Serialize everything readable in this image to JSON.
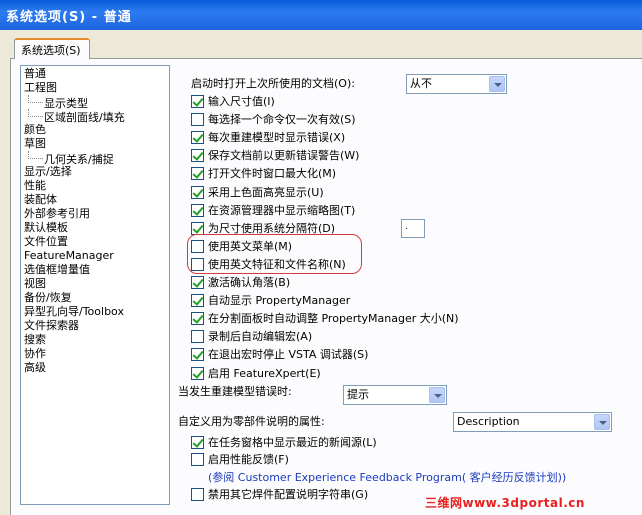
{
  "window": {
    "title": "系统选项(S) - 普通"
  },
  "tab": {
    "label": "系统选项(S)"
  },
  "tree": [
    {
      "label": "普通",
      "level": 1
    },
    {
      "label": "工程图",
      "level": 1
    },
    {
      "label": "显示类型",
      "level": 2
    },
    {
      "label": "区域剖面线/填充",
      "level": 2
    },
    {
      "label": "颜色",
      "level": 1
    },
    {
      "label": "草图",
      "level": 1
    },
    {
      "label": "几何关系/捕捉",
      "level": 2
    },
    {
      "label": "显示/选择",
      "level": 1
    },
    {
      "label": "性能",
      "level": 1
    },
    {
      "label": "装配体",
      "level": 1
    },
    {
      "label": "外部参考引用",
      "level": 1
    },
    {
      "label": "默认模板",
      "level": 1
    },
    {
      "label": "文件位置",
      "level": 1
    },
    {
      "label": "FeatureManager",
      "level": 1
    },
    {
      "label": "选值框增量值",
      "level": 1
    },
    {
      "label": "视图",
      "level": 1
    },
    {
      "label": "备份/恢复",
      "level": 1
    },
    {
      "label": "异型孔向导/Toolbox",
      "level": 1
    },
    {
      "label": "文件探索器",
      "level": 1
    },
    {
      "label": "搜索",
      "level": 1
    },
    {
      "label": "协作",
      "level": 1
    },
    {
      "label": "高级",
      "level": 1
    }
  ],
  "startup": {
    "label": "启动时打开上次所使用的文档(O):",
    "value": "从不"
  },
  "options": [
    {
      "label": "输入尺寸值(I)",
      "checked": true
    },
    {
      "label": "每选择一个命令仅一次有效(S)",
      "checked": false
    },
    {
      "label": "每次重建模型时显示错误(X)",
      "checked": true
    },
    {
      "label": "保存文档前以更新错误警告(W)",
      "checked": true
    },
    {
      "label": "打开文件时窗口最大化(M)",
      "checked": true
    },
    {
      "label": "采用上色面高亮显示(U)",
      "checked": true
    },
    {
      "label": "在资源管理器中显示缩略图(T)",
      "checked": true
    },
    {
      "label": "为尺寸使用系统分隔符(D)",
      "checked": true
    },
    {
      "label": "使用英文菜单(M)",
      "checked": false
    },
    {
      "label": "使用英文特征和文件名称(N)",
      "checked": false
    },
    {
      "label": "激活确认角落(B)",
      "checked": true
    },
    {
      "label": "自动显示 PropertyManager",
      "checked": true
    },
    {
      "label": "在分割面板时自动调整 PropertyManager 大小(N)",
      "checked": true
    },
    {
      "label": "录制后自动编辑宏(A)",
      "checked": false
    },
    {
      "label": "在退出宏时停止 VSTA 调试器(S)",
      "checked": true
    },
    {
      "label": "启用 FeatureXpert(E)",
      "checked": true
    }
  ],
  "separator_value": ".",
  "rebuild": {
    "label": "当发生重建模型错误时:",
    "value": "提示"
  },
  "custom_prop": {
    "label": "自定义用为零部件说明的属性:",
    "value": "Description"
  },
  "options2": [
    {
      "label": "在任务窗格中显示最近的新闻源(L)",
      "checked": true
    },
    {
      "label": "启用性能反馈(F)",
      "checked": false
    }
  ],
  "ceip_link": "(参阅 Customer Experience Feedback Program( 客户经历反馈计划))",
  "options3": [
    {
      "label": "禁用其它焊件配置说明字符串(G)",
      "checked": false
    }
  ],
  "watermark": "三维网www.3dportal.cn"
}
